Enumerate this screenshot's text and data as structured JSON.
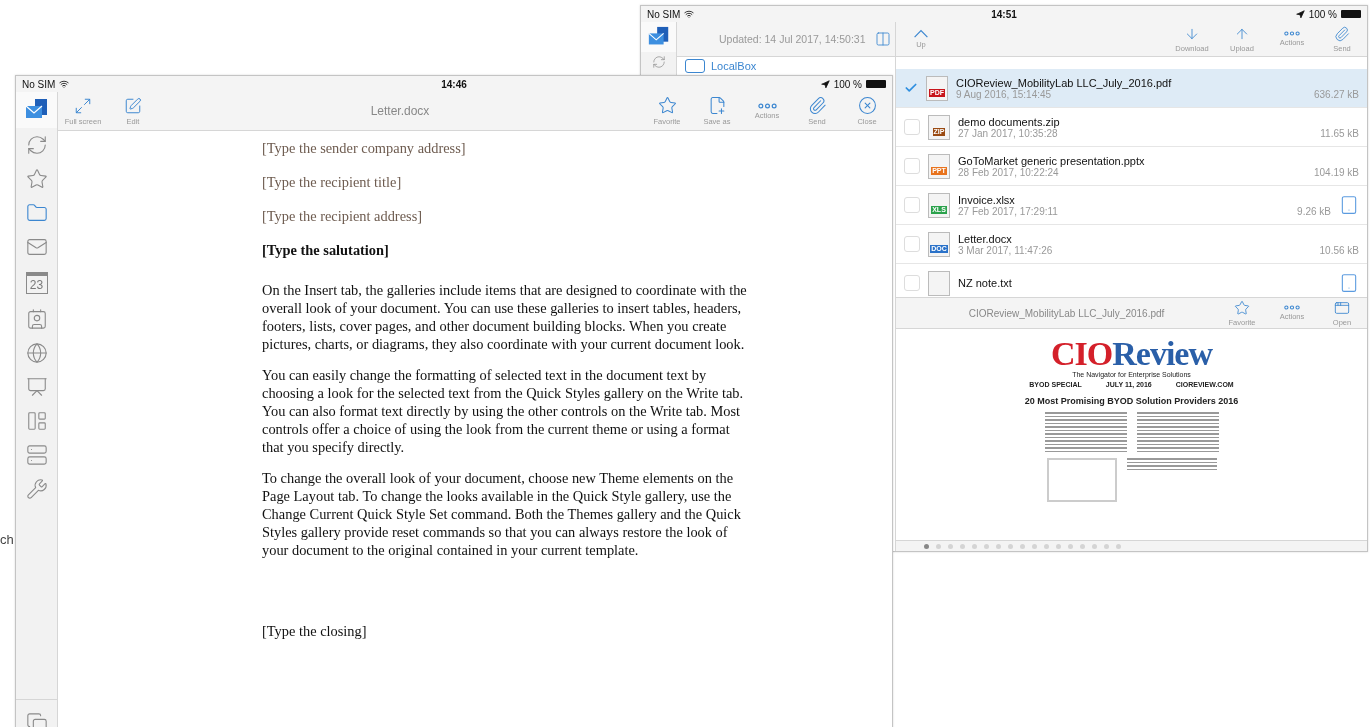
{
  "edge_text": "ch",
  "back_window": {
    "status_bar": {
      "carrier": "No SIM",
      "time": "14:51",
      "battery": "100 %"
    },
    "updated": "Updated: 14 Jul 2017, 14:50:31",
    "locations": [
      {
        "label": "LocalBox"
      }
    ],
    "up_button": "Up",
    "actions": [
      {
        "label": "Download"
      },
      {
        "label": "Upload"
      },
      {
        "label": "Actions"
      },
      {
        "label": "Send"
      }
    ],
    "files": [
      {
        "name": "CIOReview_MobilityLab LLC_July_2016.pdf",
        "date": "9 Aug 2016, 15:14:45",
        "size": "636.27 kB",
        "type_label": "PDF",
        "color": "#c8151b",
        "selected": true,
        "on_device": false
      },
      {
        "name": "demo documents.zip",
        "date": "27 Jan 2017, 10:35:28",
        "size": "11.65 kB",
        "type_label": "ZIP",
        "color": "#9a4a12",
        "selected": false,
        "on_device": false
      },
      {
        "name": "GoToMarket generic presentation.pptx",
        "date": "28 Feb 2017, 10:22:24",
        "size": "104.19 kB",
        "type_label": "PPT",
        "color": "#e8731d",
        "selected": false,
        "on_device": false
      },
      {
        "name": "Invoice.xlsx",
        "date": "27 Feb 2017, 17:29:11",
        "size": "9.26 kB",
        "type_label": "XLS",
        "color": "#2ba24c",
        "selected": false,
        "on_device": true
      },
      {
        "name": "Letter.docx",
        "date": "3 Mar 2017, 11:47:26",
        "size": "10.56 kB",
        "type_label": "DOC",
        "color": "#2a72c9",
        "selected": false,
        "on_device": false
      },
      {
        "name": "NZ note.txt",
        "selected": false,
        "on_device": true
      }
    ],
    "preview": {
      "title": "CIOReview_MobilityLab LLC_July_2016.pdf",
      "actions": [
        {
          "label": "Favorite"
        },
        {
          "label": "Actions"
        },
        {
          "label": "Open"
        }
      ],
      "document": {
        "logo_red": "CIO",
        "logo_blue": "Review",
        "tagline": "The Navigator for Enterprise Solutions",
        "meta": [
          "BYOD SPECIAL",
          "JULY 11, 2016",
          "CIOREVIEW.COM"
        ],
        "headline": "20 Most Promising BYOD Solution Providers 2016"
      },
      "pages": [
        {
          "selected": true
        },
        {
          "selected": false
        },
        {
          "selected": false
        },
        {
          "selected": false
        },
        {
          "selected": false
        },
        {
          "selected": false
        },
        {
          "selected": false
        },
        {
          "selected": false
        },
        {
          "selected": false
        },
        {
          "selected": false
        },
        {
          "selected": false
        },
        {
          "selected": false
        },
        {
          "selected": false
        },
        {
          "selected": false
        },
        {
          "selected": false
        },
        {
          "selected": false
        },
        {
          "selected": false
        }
      ]
    }
  },
  "front_window": {
    "status_bar": {
      "carrier": "No SIM",
      "time": "14:46",
      "battery": "100 %"
    },
    "toolbar_left": [
      {
        "label": "Full screen"
      },
      {
        "label": "Edit"
      }
    ],
    "title": "Letter.docx",
    "toolbar_right": [
      {
        "label": "Favorite"
      },
      {
        "label": "Save as"
      },
      {
        "label": "Actions"
      },
      {
        "label": "Send"
      },
      {
        "label": "Close"
      }
    ],
    "sidebar": {
      "calendar_day": "23",
      "items": [
        {
          "selected": false
        },
        {
          "selected": false
        },
        {
          "selected": true
        },
        {
          "selected": false
        },
        {
          "selected": false
        },
        {
          "selected": false
        },
        {
          "selected": false
        },
        {
          "selected": false
        },
        {
          "selected": false
        },
        {
          "selected": false
        },
        {
          "selected": false
        }
      ]
    },
    "document": [
      {
        "kind": "placeholder",
        "text": "[Type the sender company address]"
      },
      {
        "kind": "placeholder",
        "text": "[Type the recipient title]"
      },
      {
        "kind": "placeholder",
        "text": "[Type the recipient address]"
      },
      {
        "kind": "heading",
        "text": "[Type the salutation]"
      },
      {
        "kind": "paragraph",
        "text": "On the Insert tab, the galleries include items that are designed to coordinate with the overall look of your document.  You can use these galleries to insert tables, headers, footers, lists, cover pages, and other document building blocks.  When you create pictures, charts, or diagrams, they also coordinate with your current document look."
      },
      {
        "kind": "paragraph",
        "text": "You can easily change the formatting of selected text in the document text by choosing a look for the selected text from the Quick Styles gallery on the Write tab.  You can also format text directly by using the other controls on the Write tab.  Most controls offer a choice of using the look from the current theme or using a format that you specify directly."
      },
      {
        "kind": "paragraph",
        "text": "To change the overall look of your document, choose new Theme elements on the Page Layout tab.  To change the looks available in the Quick Style gallery, use the Change Current Quick Style Set command.  Both the Themes gallery and the Quick Styles gallery provide reset commands so that you can always restore the look of your document to the original contained in your current template."
      },
      {
        "kind": "closing",
        "text": "[Type the closing]"
      }
    ]
  }
}
